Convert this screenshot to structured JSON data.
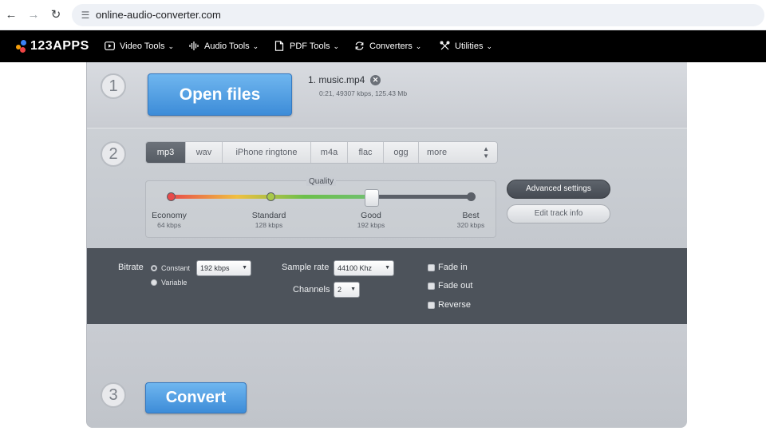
{
  "browser": {
    "url": "online-audio-converter.com"
  },
  "nav": {
    "logo_text": "123APPS",
    "items": [
      {
        "label": "Video Tools",
        "icon": "play-box-icon"
      },
      {
        "label": "Audio Tools",
        "icon": "audio-wave-icon"
      },
      {
        "label": "PDF Tools",
        "icon": "document-icon"
      },
      {
        "label": "Converters",
        "icon": "refresh-icon"
      },
      {
        "label": "Utilities",
        "icon": "tools-icon"
      }
    ]
  },
  "step1": {
    "number": "1",
    "open_label": "Open files",
    "file_name": "1. music.mp4",
    "file_meta": "0:21, 49307 kbps, 125.43 Mb"
  },
  "step2": {
    "number": "2",
    "formats": [
      "mp3",
      "wav",
      "iPhone ringtone",
      "m4a",
      "flac",
      "ogg",
      "more"
    ],
    "selected_format": "mp3",
    "quality_label": "Quality",
    "quality_levels": [
      {
        "label": "Economy",
        "sub": "64 kbps"
      },
      {
        "label": "Standard",
        "sub": "128 kbps"
      },
      {
        "label": "Good",
        "sub": "192 kbps"
      },
      {
        "label": "Best",
        "sub": "320 kbps"
      }
    ],
    "quality_selected_index": 2,
    "advanced_label": "Advanced settings",
    "edit_label": "Edit track info"
  },
  "advanced": {
    "bitrate_label": "Bitrate",
    "bitrate_constant": "Constant",
    "bitrate_variable": "Variable",
    "bitrate_value": "192 kbps",
    "sample_rate_label": "Sample rate",
    "sample_rate_value": "44100 Khz",
    "channels_label": "Channels",
    "channels_value": "2",
    "fade_in": "Fade in",
    "fade_out": "Fade out",
    "reverse": "Reverse"
  },
  "step3": {
    "number": "3",
    "convert_label": "Convert"
  },
  "colors": {
    "accent_blue": "#3d8cd8",
    "nav_bg": "#000000",
    "dark_panel": "#4d535b"
  }
}
